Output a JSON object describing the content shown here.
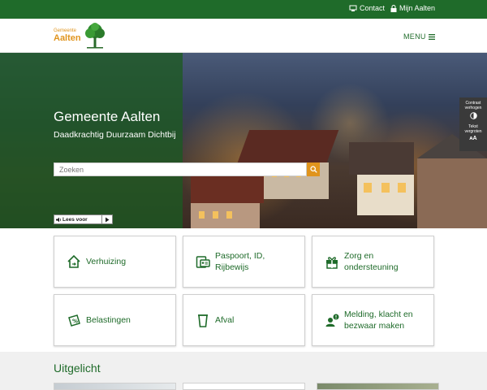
{
  "topbar": {
    "contact_label": "Contact",
    "mijn_label": "Mijn Aalten"
  },
  "header": {
    "logo_small": "Gemeente",
    "logo_big": "Aalten",
    "menu_label": "MENU"
  },
  "hero": {
    "title": "Gemeente Aalten",
    "subtitle": "Daadkrachtig Duurzaam Dichtbij",
    "search_placeholder": "Zoeken",
    "leesvoor_label": "Lees voor"
  },
  "accessibility": {
    "contrast_label": "Contrast verhogen",
    "text_label": "Tekst vergroten"
  },
  "tiles": [
    {
      "label": "Verhuizing",
      "icon": "house-arrow-icon"
    },
    {
      "label": "Paspoort, ID, Rijbewijs",
      "icon": "id-card-icon"
    },
    {
      "label": "Zorg en ondersteuning",
      "icon": "gift-icon"
    },
    {
      "label": "Belastingen",
      "icon": "tax-icon"
    },
    {
      "label": "Afval",
      "icon": "trash-bin-icon"
    },
    {
      "label": "Melding, klacht en bezwaar maken",
      "icon": "report-person-icon"
    }
  ],
  "featured": {
    "title": "Uitgelicht"
  },
  "colors": {
    "brand_green": "#1f6b2a",
    "accent_orange": "#e0941d"
  }
}
